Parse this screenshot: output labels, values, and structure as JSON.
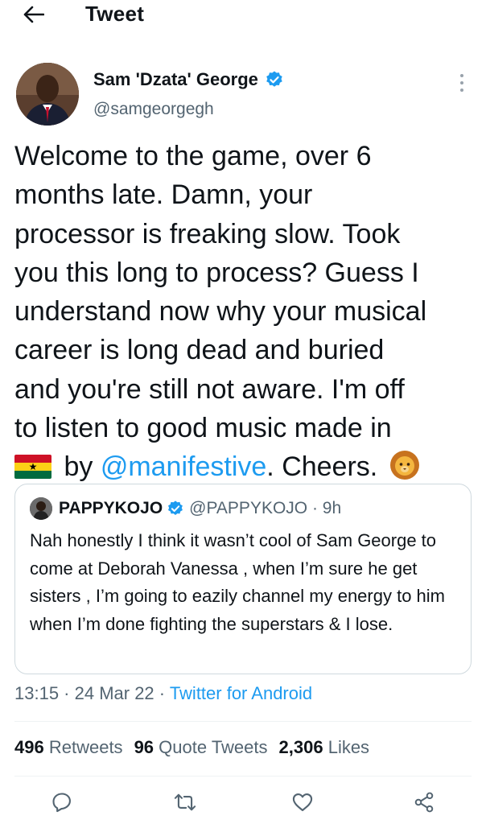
{
  "header": {
    "title": "Tweet"
  },
  "author": {
    "name": "Sam 'Dzata' George",
    "handle": "@samgeorgegh"
  },
  "tweet": {
    "line1": "Welcome to the game, over 6\nmonths late. Damn, your\nprocessor is freaking slow. Took\nyou this long to process? Guess I\nunderstand now why your musical\ncareer is long dead and buried\nand you're still not aware. I'm off\nto listen to good music made in\n",
    "by": " by ",
    "mention": "@manifestive",
    "tail": ". Cheers. "
  },
  "quote": {
    "name": "PAPPYKOJO",
    "meta": "@PAPPYKOJO · 9h",
    "text": "Nah honestly I think it wasn’t cool of Sam George to come at Deborah Vanessa , when I’m sure he get sisters , I’m going to eazily channel my energy to him when I’m done fighting the superstars & I lose."
  },
  "timestamp": {
    "time": "13:15 · 24 Mar 22 · ",
    "source": "Twitter for Android"
  },
  "stats": {
    "retweets_count": "496",
    "retweets_label": "Retweets",
    "quotes_count": "96",
    "quotes_label": "Quote Tweets",
    "likes_count": "2,306",
    "likes_label": "Likes"
  },
  "colors": {
    "accent": "#1d9bf0",
    "secondary_text": "#536471",
    "text": "#0f1419"
  },
  "icons": [
    "back-arrow-icon",
    "verified-badge-icon",
    "more-options-icon",
    "ghana-flag-emoji",
    "lion-emoji",
    "reply-icon",
    "retweet-icon",
    "like-icon",
    "share-icon"
  ]
}
